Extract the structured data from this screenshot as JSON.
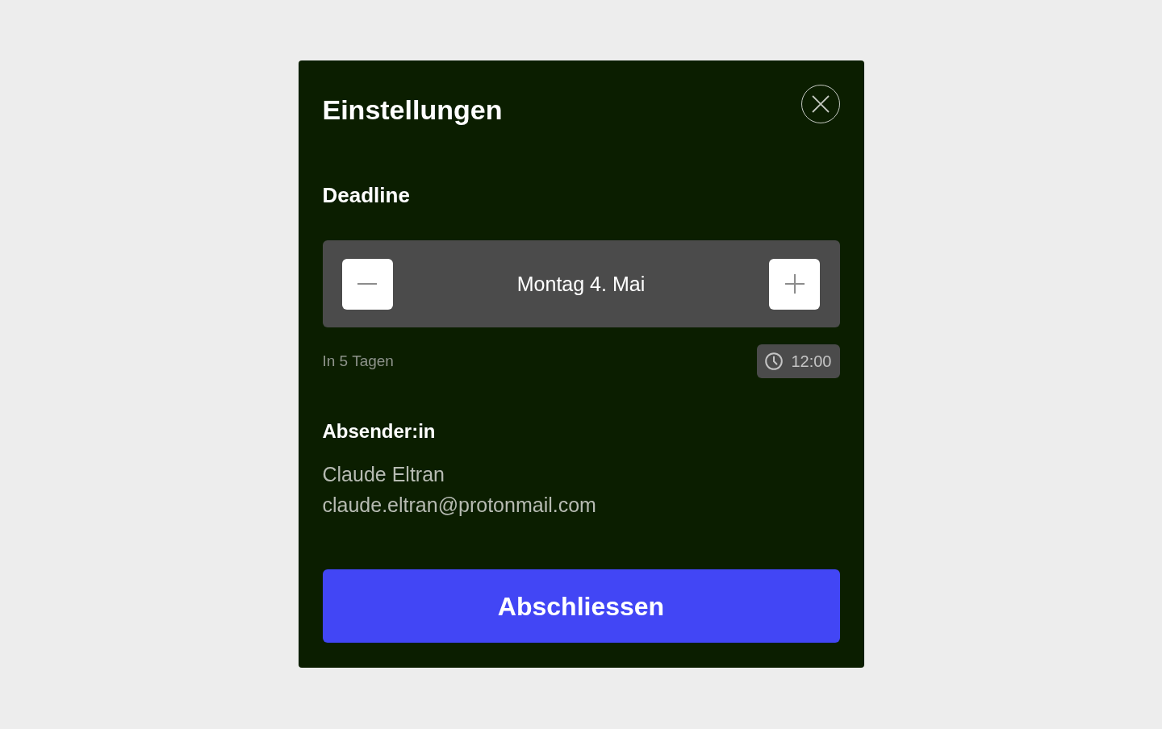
{
  "dialog": {
    "title": "Einstellungen"
  },
  "deadline": {
    "label": "Deadline",
    "date": "Montag 4. Mai",
    "relative": "In 5 Tagen",
    "time": "12:00"
  },
  "sender": {
    "label": "Absender:in",
    "name": "Claude Eltran",
    "email": "claude.eltran@protonmail.com"
  },
  "primary_button": {
    "label": "Abschliessen"
  }
}
